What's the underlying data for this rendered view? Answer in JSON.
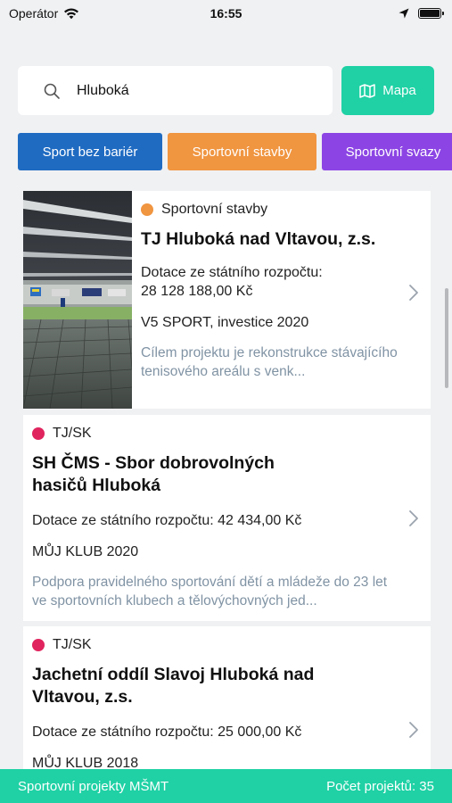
{
  "status_bar": {
    "carrier": "Operátor",
    "time": "16:55",
    "icons": [
      "wifi-icon",
      "location-icon",
      "battery-icon"
    ]
  },
  "search": {
    "value": "Hluboká",
    "placeholder": ""
  },
  "map_button": {
    "label": "Mapa",
    "icon": "map-icon"
  },
  "filters": [
    {
      "label": "Sport bez bariér",
      "color": "#1f6bc2"
    },
    {
      "label": "Sportovní stavby",
      "color": "#f09540"
    },
    {
      "label": "Sportovní svazy",
      "color": "#8c45e4"
    }
  ],
  "cards": [
    {
      "category": "Sportovní stavby",
      "category_color": "#f09540",
      "title": "TJ Hluboká nad Vltavou, z.s.",
      "subsidy_label": "Dotace ze státního rozpočtu:",
      "subsidy_value": "28 128 188,00 Kč",
      "program": "V5 SPORT, investice 2020",
      "description": "Cílem projektu je rekonstrukce stávajícího tenisového areálu s venk..."
    },
    {
      "category": "TJ/SK",
      "category_color": "#e0245e",
      "title": "SH ČMS - Sbor dobrovolných hasičů Hluboká",
      "subsidy": "Dotace ze státního rozpočtu: 42 434,00 Kč",
      "program": "MŮJ KLUB 2020",
      "description": "Podpora pravidelného sportování dětí a mládeže do 23 let ve sportovních klubech a tělovýchovných jed..."
    },
    {
      "category": "TJ/SK",
      "category_color": "#e0245e",
      "title": "Jachetní oddíl Slavoj Hluboká nad Vltavou, z.s.",
      "subsidy": "Dotace ze státního rozpočtu: 25 000,00 Kč",
      "program": "MŮJ KLUB 2018"
    }
  ],
  "footer": {
    "left": "Sportovní projekty MŠMT",
    "right": "Počet projektů: 35"
  },
  "colors": {
    "accent": "#1fd1a5",
    "background": "#f0f1f3",
    "description_text": "#8093a4"
  }
}
